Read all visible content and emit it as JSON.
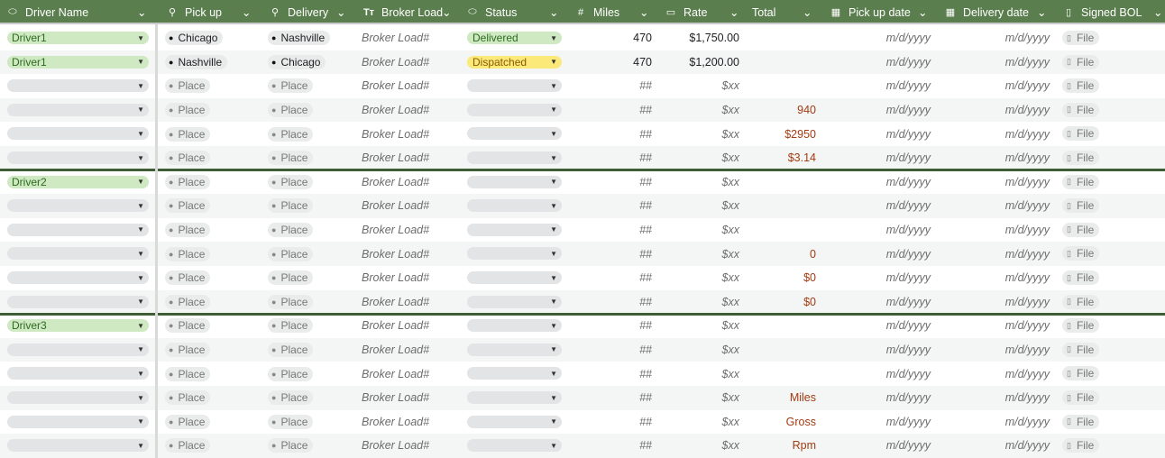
{
  "header": {
    "columns": [
      {
        "label": "Driver Name",
        "icon": "tag-icon"
      },
      {
        "label": "Pick up",
        "icon": "location-icon"
      },
      {
        "label": "Delivery",
        "icon": "location-icon"
      },
      {
        "label": "Broker Load",
        "icon": "text-icon"
      },
      {
        "label": "Status",
        "icon": "tag-icon"
      },
      {
        "label": "Miles",
        "icon": "number-icon"
      },
      {
        "label": "Rate",
        "icon": "currency-icon"
      },
      {
        "label": "Total",
        "icon": ""
      },
      {
        "label": "Pick up date",
        "icon": "calendar-icon"
      },
      {
        "label": "Delivery date",
        "icon": "calendar-icon"
      },
      {
        "label": "Signed BOL",
        "icon": "file-icon"
      }
    ]
  },
  "colors": {
    "header_bg": "#5b7e4e",
    "group_separator": "#3f5e36",
    "chip_green": "#cfe9c2",
    "chip_yellow": "#fbe97a",
    "total_text": "#a23c11"
  },
  "rows": [
    {
      "driver": "Driver1",
      "pickup": "Chicago",
      "delivery": "Nashville",
      "broker": "Broker Load#",
      "status": "Delivered",
      "miles": "470",
      "rate": "$1,750.00",
      "total": "",
      "pickup_date": "m/d/yyyy",
      "delivery_date": "m/d/yyyy",
      "bol": "File"
    },
    {
      "driver": "Driver1",
      "pickup": "Nashville",
      "delivery": "Chicago",
      "broker": "Broker Load#",
      "status": "Dispatched",
      "miles": "470",
      "rate": "$1,200.00",
      "total": "",
      "pickup_date": "m/d/yyyy",
      "delivery_date": "m/d/yyyy",
      "bol": "File"
    },
    {
      "driver": "",
      "pickup": "Place",
      "delivery": "Place",
      "broker": "Broker Load#",
      "status": "",
      "miles": "##",
      "rate": "$xx",
      "total": "",
      "pickup_date": "m/d/yyyy",
      "delivery_date": "m/d/yyyy",
      "bol": "File"
    },
    {
      "driver": "",
      "pickup": "Place",
      "delivery": "Place",
      "broker": "Broker Load#",
      "status": "",
      "miles": "##",
      "rate": "$xx",
      "total": "940",
      "pickup_date": "m/d/yyyy",
      "delivery_date": "m/d/yyyy",
      "bol": "File"
    },
    {
      "driver": "",
      "pickup": "Place",
      "delivery": "Place",
      "broker": "Broker Load#",
      "status": "",
      "miles": "##",
      "rate": "$xx",
      "total": "$2950",
      "pickup_date": "m/d/yyyy",
      "delivery_date": "m/d/yyyy",
      "bol": "File"
    },
    {
      "driver": "",
      "pickup": "Place",
      "delivery": "Place",
      "broker": "Broker Load#",
      "status": "",
      "miles": "##",
      "rate": "$xx",
      "total": "$3.14",
      "pickup_date": "m/d/yyyy",
      "delivery_date": "m/d/yyyy",
      "bol": "File"
    },
    {
      "driver": "Driver2",
      "pickup": "Place",
      "delivery": "Place",
      "broker": "Broker Load#",
      "status": "",
      "miles": "##",
      "rate": "$xx",
      "total": "",
      "pickup_date": "m/d/yyyy",
      "delivery_date": "m/d/yyyy",
      "bol": "File"
    },
    {
      "driver": "",
      "pickup": "Place",
      "delivery": "Place",
      "broker": "Broker Load#",
      "status": "",
      "miles": "##",
      "rate": "$xx",
      "total": "",
      "pickup_date": "m/d/yyyy",
      "delivery_date": "m/d/yyyy",
      "bol": "File"
    },
    {
      "driver": "",
      "pickup": "Place",
      "delivery": "Place",
      "broker": "Broker Load#",
      "status": "",
      "miles": "##",
      "rate": "$xx",
      "total": "",
      "pickup_date": "m/d/yyyy",
      "delivery_date": "m/d/yyyy",
      "bol": "File"
    },
    {
      "driver": "",
      "pickup": "Place",
      "delivery": "Place",
      "broker": "Broker Load#",
      "status": "",
      "miles": "##",
      "rate": "$xx",
      "total": "0",
      "pickup_date": "m/d/yyyy",
      "delivery_date": "m/d/yyyy",
      "bol": "File"
    },
    {
      "driver": "",
      "pickup": "Place",
      "delivery": "Place",
      "broker": "Broker Load#",
      "status": "",
      "miles": "##",
      "rate": "$xx",
      "total": "$0",
      "pickup_date": "m/d/yyyy",
      "delivery_date": "m/d/yyyy",
      "bol": "File"
    },
    {
      "driver": "",
      "pickup": "Place",
      "delivery": "Place",
      "broker": "Broker Load#",
      "status": "",
      "miles": "##",
      "rate": "$xx",
      "total": "$0",
      "pickup_date": "m/d/yyyy",
      "delivery_date": "m/d/yyyy",
      "bol": "File"
    },
    {
      "driver": "Driver3",
      "pickup": "Place",
      "delivery": "Place",
      "broker": "Broker Load#",
      "status": "",
      "miles": "##",
      "rate": "$xx",
      "total": "",
      "pickup_date": "m/d/yyyy",
      "delivery_date": "m/d/yyyy",
      "bol": "File"
    },
    {
      "driver": "",
      "pickup": "Place",
      "delivery": "Place",
      "broker": "Broker Load#",
      "status": "",
      "miles": "##",
      "rate": "$xx",
      "total": "",
      "pickup_date": "m/d/yyyy",
      "delivery_date": "m/d/yyyy",
      "bol": "File"
    },
    {
      "driver": "",
      "pickup": "Place",
      "delivery": "Place",
      "broker": "Broker Load#",
      "status": "",
      "miles": "##",
      "rate": "$xx",
      "total": "",
      "pickup_date": "m/d/yyyy",
      "delivery_date": "m/d/yyyy",
      "bol": "File"
    },
    {
      "driver": "",
      "pickup": "Place",
      "delivery": "Place",
      "broker": "Broker Load#",
      "status": "",
      "miles": "##",
      "rate": "$xx",
      "total": "Miles",
      "pickup_date": "m/d/yyyy",
      "delivery_date": "m/d/yyyy",
      "bol": "File"
    },
    {
      "driver": "",
      "pickup": "Place",
      "delivery": "Place",
      "broker": "Broker Load#",
      "status": "",
      "miles": "##",
      "rate": "$xx",
      "total": "Gross",
      "pickup_date": "m/d/yyyy",
      "delivery_date": "m/d/yyyy",
      "bol": "File"
    },
    {
      "driver": "",
      "pickup": "Place",
      "delivery": "Place",
      "broker": "Broker Load#",
      "status": "",
      "miles": "##",
      "rate": "$xx",
      "total": "Rpm",
      "pickup_date": "m/d/yyyy",
      "delivery_date": "m/d/yyyy",
      "bol": "File"
    }
  ]
}
